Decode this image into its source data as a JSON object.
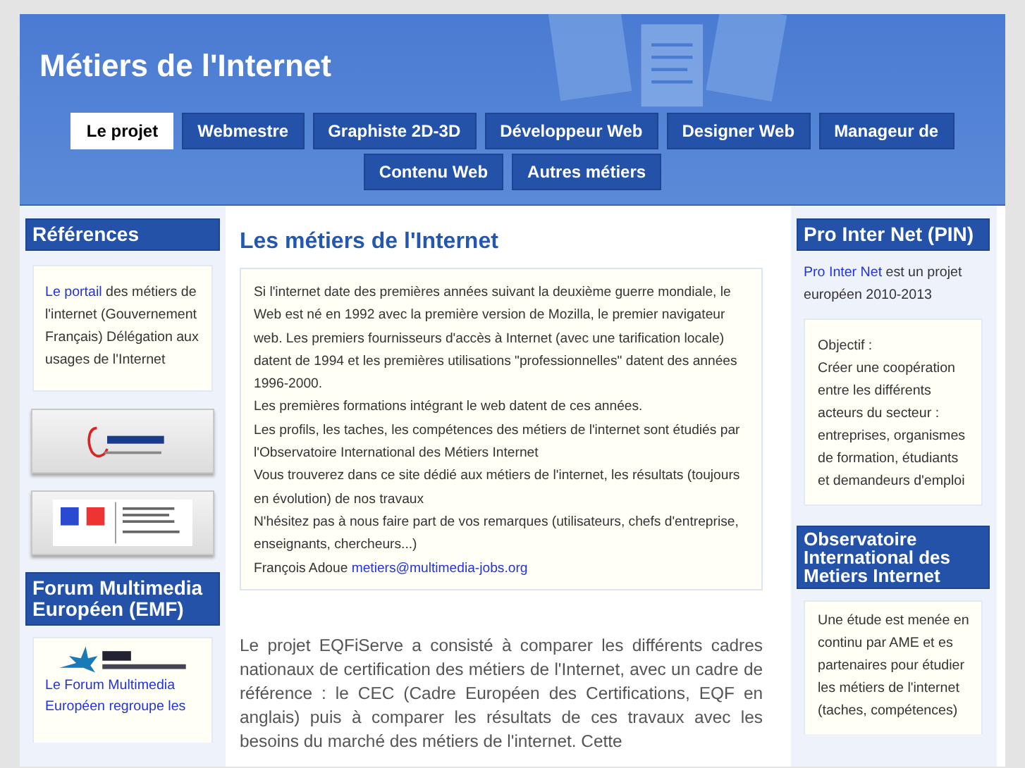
{
  "site": {
    "title": "Métiers de l'Internet"
  },
  "tabs": [
    {
      "label": "Le projet",
      "selected": true
    },
    {
      "label": "Webmestre",
      "selected": false
    },
    {
      "label": "Graphiste 2D-3D",
      "selected": false
    },
    {
      "label": "Développeur Web",
      "selected": false
    },
    {
      "label": "Designer Web",
      "selected": false
    },
    {
      "label": "Manageur de",
      "selected": false
    },
    {
      "label": "Contenu Web",
      "selected": false
    },
    {
      "label": "Autres métiers",
      "selected": false
    }
  ],
  "left_sidebar": {
    "references": {
      "heading": "Références",
      "link": "Le portail",
      "text": "des métiers de l'internet (Gouvernement Français) Délégation aux usages de l'Internet"
    },
    "forum": {
      "heading": "Forum Multimedia Européen (EMF)",
      "link": "Le Forum Multimedia Européen regroupe les"
    }
  },
  "main": {
    "title": "Les métiers de l'Internet",
    "intro_lines": [
      "Si l'internet date des premières années suivant la deuxième guerre mondiale, le Web est né en 1992 avec la première version de Mozilla, le premier navigateur web. Les premiers fournisseurs d'accès à Internet (avec une tarification locale) datent de 1994 et les premières utilisations \"professionnelles\" datent des années 1996-2000.",
      "Les premières formations intégrant le web datent de ces années.",
      "Les profils, les taches, les compétences des métiers de l'internet sont étudiés par l'Observatoire International des Métiers Internet",
      "Vous trouverez dans ce site dédié aux métiers de l'internet, les résultats (toujours en évolution) de nos travaux",
      "N'hésitez pas à nous faire part de vos remarques (utilisateurs, chefs d'entreprise, enseignants, chercheurs...)"
    ],
    "signature": "François Adoue",
    "email": "metiers@multimedia-jobs.org",
    "project_text": "Le projet EQFiServe a consisté à comparer les différents cadres nationaux de certification des métiers de l'Internet, avec un cadre de référence : le CEC (Cadre Européen des Certifications, EQF en anglais) puis à comparer les résultats de ces travaux avec les besoins du marché des métiers de l'internet. Cette"
  },
  "right_sidebar": {
    "pin": {
      "heading": "Pro Inter Net (PIN)",
      "link": "Pro Inter Net",
      "text": "est un projet européen 2010-2013",
      "objective_label": "Objectif :",
      "objective_text": "Créer une coopération entre les différents acteurs du secteur : entreprises, organismes de formation, étudiants et demandeurs d'emploi"
    },
    "observatory": {
      "heading": "Observatoire International des Metiers Internet",
      "text": "Une étude est menée en continu par AME et es partenaires pour étudier les métiers de l'internet (taches, compétences)"
    }
  }
}
